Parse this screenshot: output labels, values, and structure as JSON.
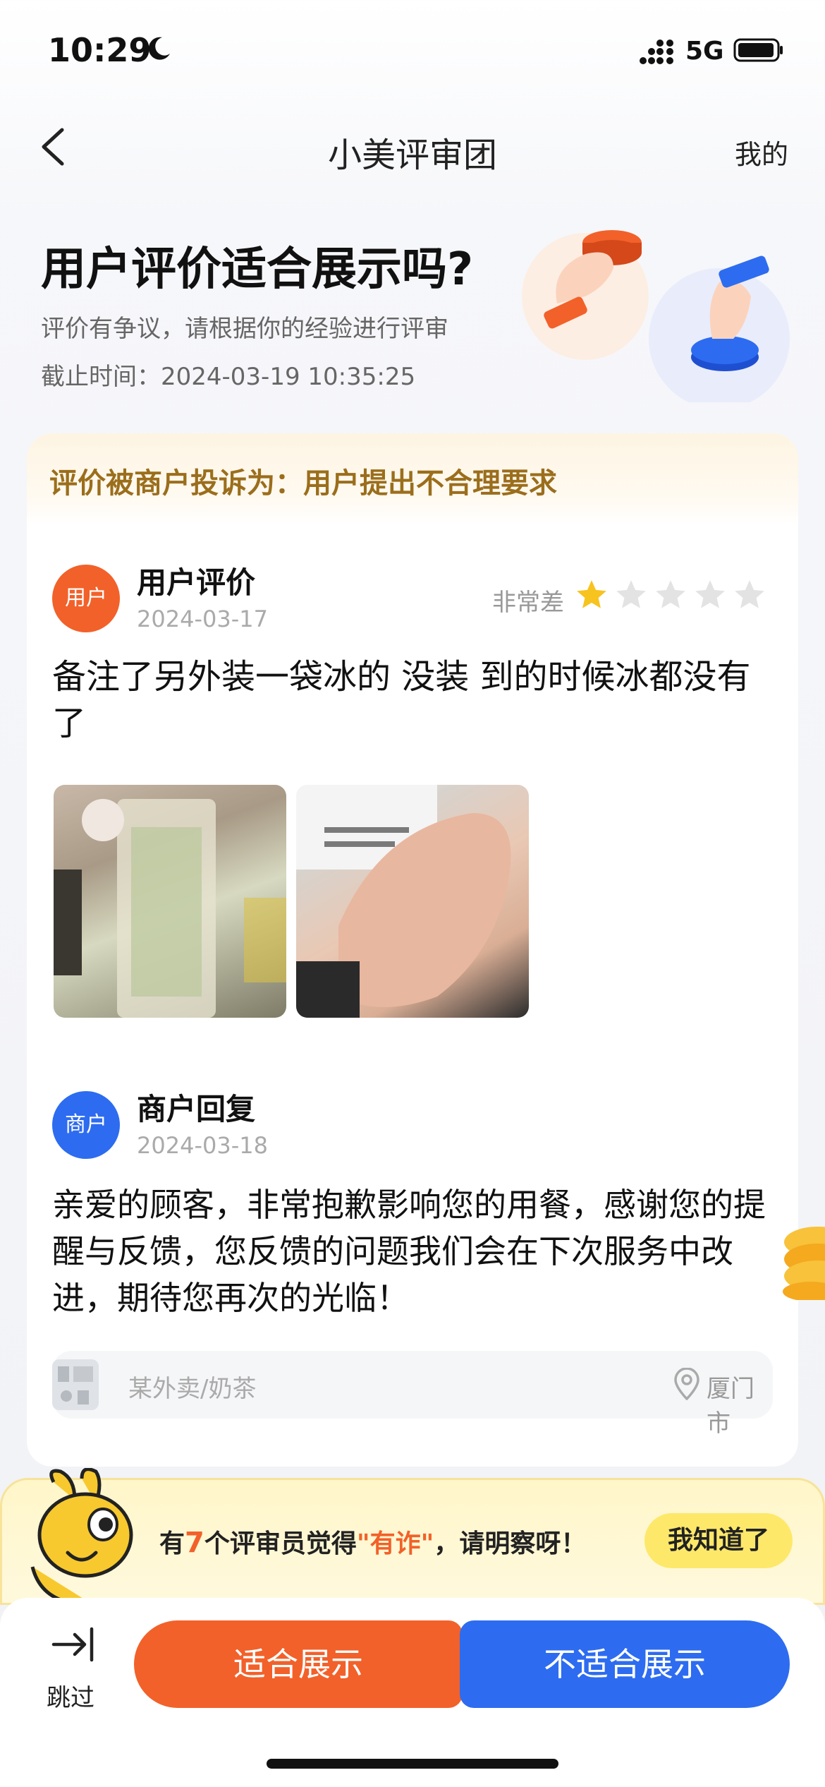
{
  "status_bar": {
    "time": "10:29",
    "network": "5G"
  },
  "nav": {
    "title": "小美评审团",
    "mine": "我的"
  },
  "hero": {
    "title": "用户评价适合展示吗?",
    "subtitle": "评价有争议，请根据你的经验进行评审",
    "deadline_label": "截止时间：",
    "deadline_value": "2024-03-19 10:35:25"
  },
  "complaint": {
    "text": "评价被商户投诉为：用户提出不合理要求"
  },
  "user_review": {
    "avatar_label": "用户",
    "title": "用户评价",
    "date": "2024-03-17",
    "rating_label": "非常差",
    "rating_stars": 1,
    "rating_max": 5,
    "text": "备注了另外装一袋冰的 没装 到的时候冰都没有了"
  },
  "merchant_reply": {
    "avatar_label": "商户",
    "title": "商户回复",
    "date": "2024-03-18",
    "text": "亲爱的顾客，非常抱歉影响您的用餐，感谢您的提醒与反馈，您反馈的问题我们会在下次服务中改进，期待您再次的光临！"
  },
  "store": {
    "name": "某外卖/奶茶",
    "city": "厦门市"
  },
  "tip": {
    "prefix": "有",
    "count": "7",
    "middle": "个评审员觉得",
    "quote": "\"有诈\"",
    "suffix": "，请明察呀！",
    "button": "我知道了"
  },
  "actions": {
    "skip": "跳过",
    "suitable": "适合展示",
    "unsuitable": "不适合展示"
  },
  "colors": {
    "orange": "#f2612a",
    "blue": "#2d6cf0",
    "complaint_text": "#9b6e1c",
    "star_active": "#f7c31f",
    "star_inactive": "#e3e3e3"
  }
}
